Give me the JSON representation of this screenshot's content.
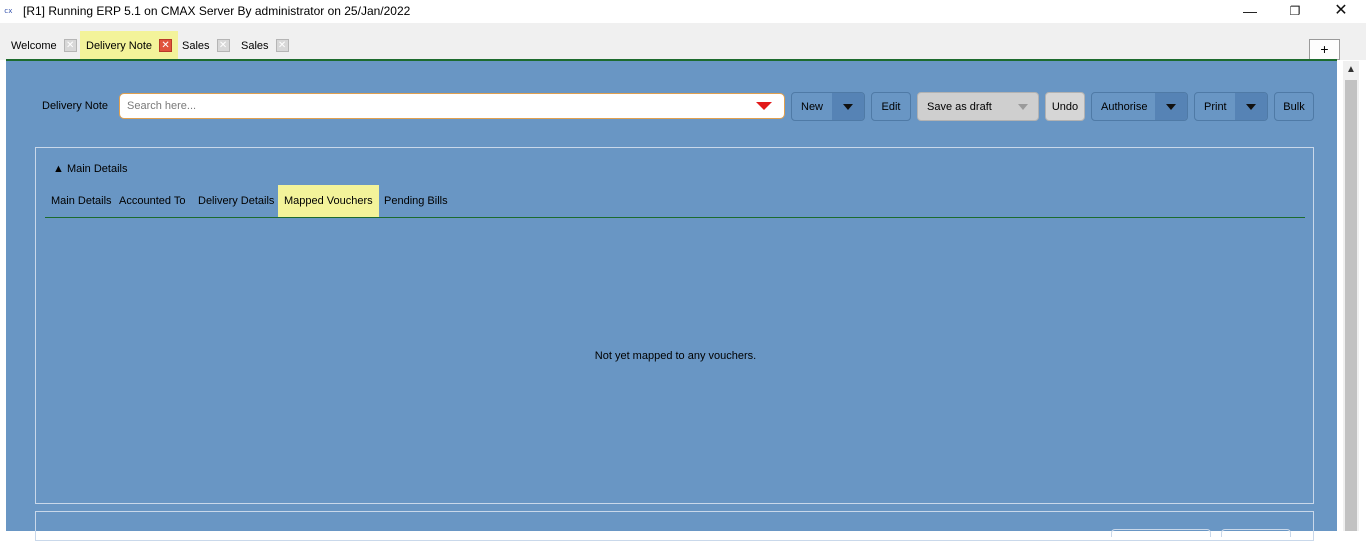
{
  "window": {
    "title": "[R1] Running ERP 5.1 on CMAX Server By administrator on 25/Jan/2022",
    "icon": "cx",
    "minimize_glyph": "—",
    "maximize_glyph": "❐",
    "close_glyph": "✕"
  },
  "tabs": [
    {
      "label": "Welcome",
      "active": false
    },
    {
      "label": "Delivery Note",
      "active": true
    },
    {
      "label": "Sales",
      "active": false
    },
    {
      "label": "Sales",
      "active": false
    }
  ],
  "tab_close_glyph": "✕",
  "add_tab_label": "+",
  "toolbar": {
    "form_label": "Delivery Note",
    "search_placeholder": "Search here...",
    "new_label": "New",
    "edit_label": "Edit",
    "save_draft_label": "Save as draft",
    "undo_label": "Undo",
    "authorise_label": "Authorise",
    "print_label": "Print",
    "bulk_label": "Bulk"
  },
  "main_details": {
    "collapse_label": "▲ Main Details",
    "subtabs": [
      {
        "label": "Main Details",
        "active": false
      },
      {
        "label": "Accounted To",
        "active": false
      },
      {
        "label": "Delivery Details",
        "active": false
      },
      {
        "label": "Mapped Vouchers",
        "active": true
      },
      {
        "label": "Pending Bills",
        "active": false
      }
    ],
    "empty_message": "Not yet mapped to any vouchers."
  },
  "scrollbar": {
    "up_arrow": "▲"
  },
  "colors": {
    "main_bg": "#6996c4",
    "active_tab": "#f3f39a",
    "accent_line": "#1d6b2e",
    "search_border": "#e0a050",
    "search_arrow": "#e21a1a"
  }
}
